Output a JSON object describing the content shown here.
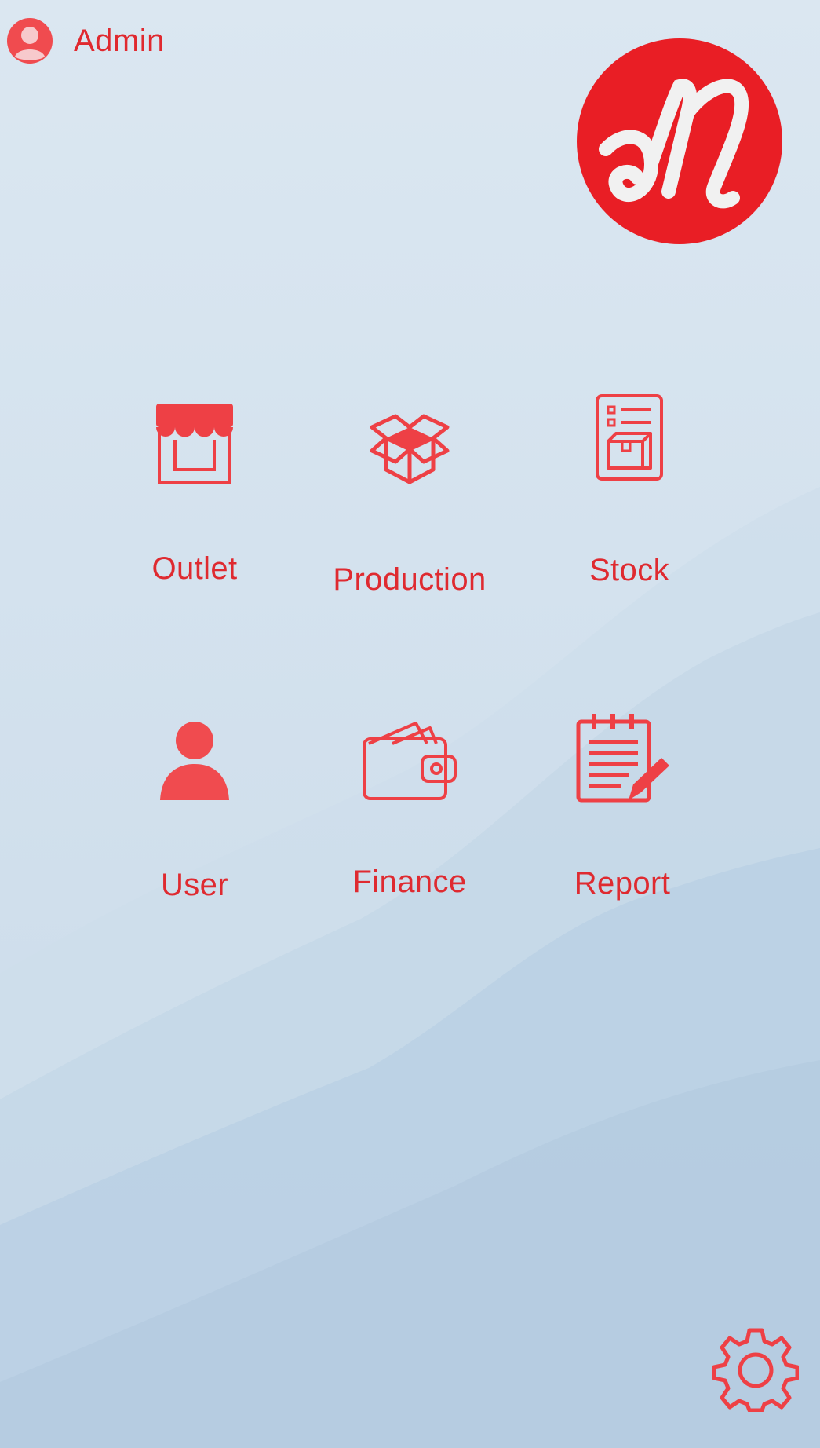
{
  "header": {
    "user_name": "Admin",
    "avatar_icon": "user-circle-icon"
  },
  "brand": {
    "logo": "brand-logo-m",
    "accent_color": "#e91e25"
  },
  "menu": {
    "items": [
      {
        "label": "Outlet",
        "icon": "storefront-icon"
      },
      {
        "label": "Production",
        "icon": "open-box-icon"
      },
      {
        "label": "Stock",
        "icon": "stock-list-icon"
      },
      {
        "label": "User",
        "icon": "person-icon"
      },
      {
        "label": "Finance",
        "icon": "wallet-icon"
      },
      {
        "label": "Report",
        "icon": "report-clipboard-icon"
      }
    ]
  },
  "footer": {
    "settings_icon": "gear-icon"
  }
}
